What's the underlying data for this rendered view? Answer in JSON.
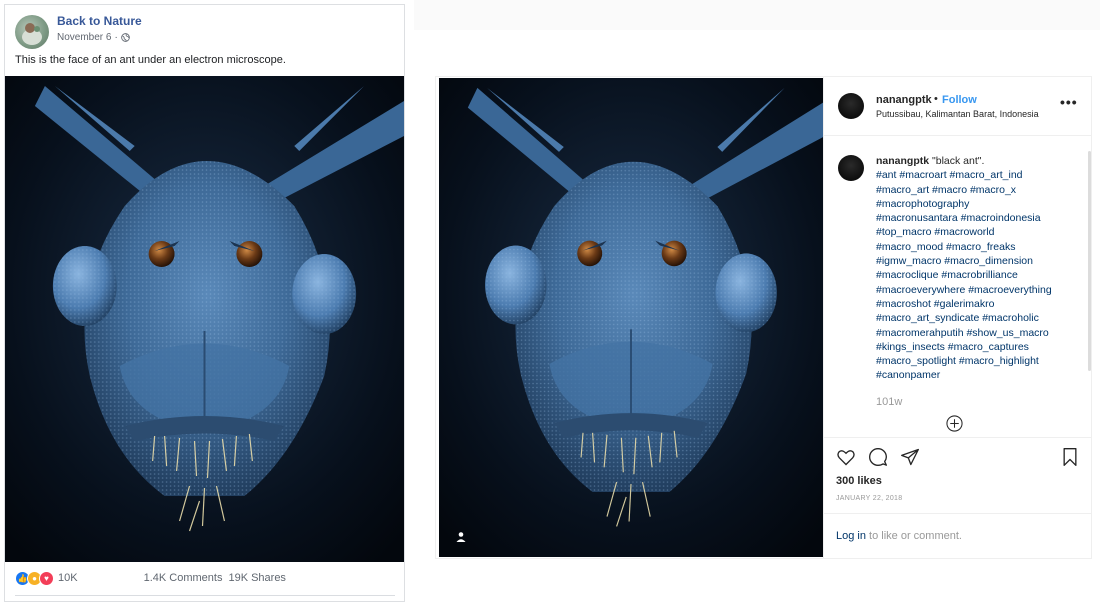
{
  "facebook": {
    "page_name": "Back to Nature",
    "date": "November 6",
    "date_sep": " · ",
    "post_text": "This is the face of an ant under an electron microscope.",
    "reaction_count": "10K",
    "comments": "1.4K Comments",
    "shares": "19K Shares",
    "reaction_icons": [
      "like-icon",
      "wow-icon",
      "love-icon"
    ]
  },
  "instagram": {
    "username": "nanangptk",
    "dot": "•",
    "follow": "Follow",
    "location": "Putussibau, Kalimantan Barat, Indonesia",
    "more": "•••",
    "caption_user": "nanangptk",
    "caption_text": "\"black ant\".",
    "hashtag_lines": [
      "#ant #macroart #macro_art_ind",
      "#macro_art #macro #macro_x",
      "#macrophotography",
      "#macronusantara #macroindonesia",
      "#top_macro #macroworld",
      "#macro_mood #macro_freaks",
      "#igmw_macro #macro_dimension",
      "#macroclique #macrobrilliance",
      "#macroeverywhere #macroeverything",
      "#macroshot #galerimakro",
      "#macro_art_syndicate #macroholic",
      "#macromerahputih #show_us_macro",
      "#kings_insects #macro_captures",
      "#macro_spotlight #macro_highlight",
      "#canonpamer"
    ],
    "time_ago": "101w",
    "likes": "300 likes",
    "post_date": "JANUARY 22, 2018",
    "login_link": "Log in",
    "login_rest": " to like or comment."
  },
  "colors": {
    "fb_link": "#385898",
    "ig_follow": "#3897f0",
    "ig_hashtag": "#003569"
  }
}
